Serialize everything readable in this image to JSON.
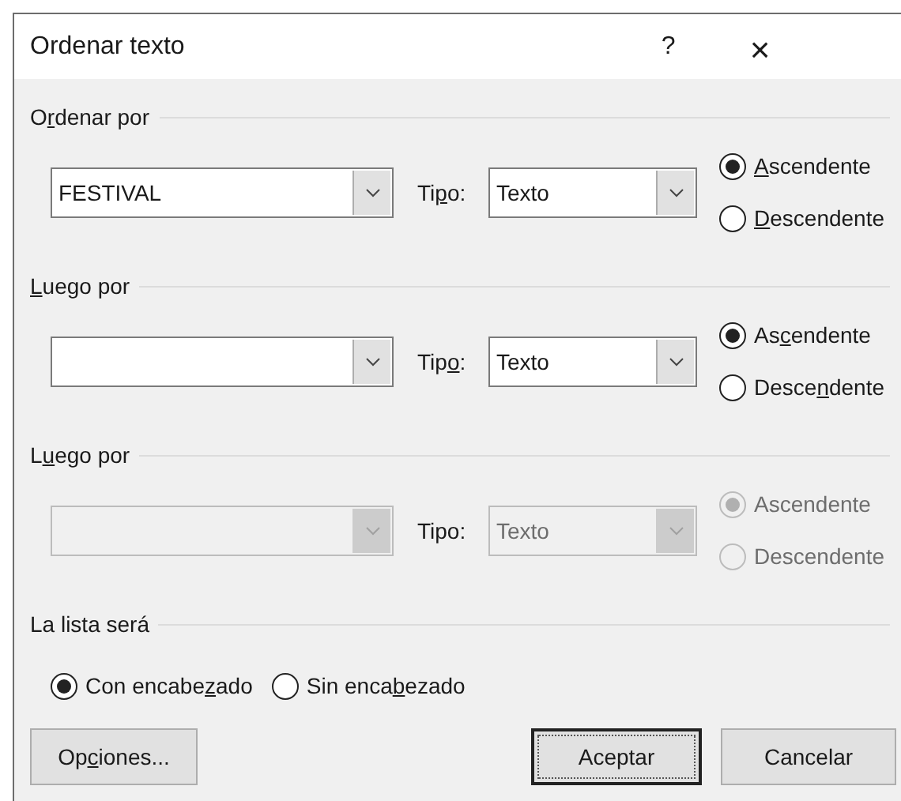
{
  "window": {
    "title": "Ordenar texto",
    "help": "?",
    "close": "×"
  },
  "sections": [
    {
      "heading": {
        "pre": "O",
        "key": "r",
        "post": "denar por"
      },
      "disabled": false,
      "field": {
        "value": "FESTIVAL"
      },
      "type_label": {
        "pre": "Ti",
        "key": "p",
        "post": "o:"
      },
      "type_value": "Texto",
      "order": [
        {
          "label": {
            "key": "A",
            "post": "scendente"
          },
          "selected": true
        },
        {
          "label": {
            "key": "D",
            "post": "escendente"
          },
          "selected": false
        }
      ]
    },
    {
      "heading": {
        "key": "L",
        "post": "uego por"
      },
      "disabled": false,
      "type_label": {
        "pre": "Tip",
        "key": "o",
        "post": ":"
      },
      "type_value": "Texto",
      "order": [
        {
          "label": {
            "pre": "As",
            "key": "c",
            "post": "endente"
          },
          "selected": true
        },
        {
          "label": {
            "pre": "Desce",
            "key": "n",
            "post": "dente"
          },
          "selected": false
        }
      ]
    },
    {
      "heading": {
        "pre": "L",
        "key": "u",
        "post": "ego por"
      },
      "disabled": true,
      "type_label": "Tipo:",
      "type_value": "Texto",
      "order": [
        {
          "label": "Ascendente",
          "selected": true
        },
        {
          "label": "Descendente",
          "selected": false
        }
      ]
    }
  ],
  "header_group": {
    "heading": "La lista será",
    "options": [
      {
        "label": {
          "pre": "Con encabe",
          "key": "z",
          "post": "ado"
        },
        "selected": true
      },
      {
        "label": {
          "pre": "Sin enca",
          "key": "b",
          "post": "ezado"
        },
        "selected": false
      }
    ]
  },
  "buttons": [
    {
      "label": {
        "pre": "Op",
        "key": "c",
        "post": "iones..."
      },
      "focused": false
    },
    {
      "label": "Aceptar",
      "focused": true
    },
    {
      "label": "Cancelar",
      "focused": false
    }
  ]
}
